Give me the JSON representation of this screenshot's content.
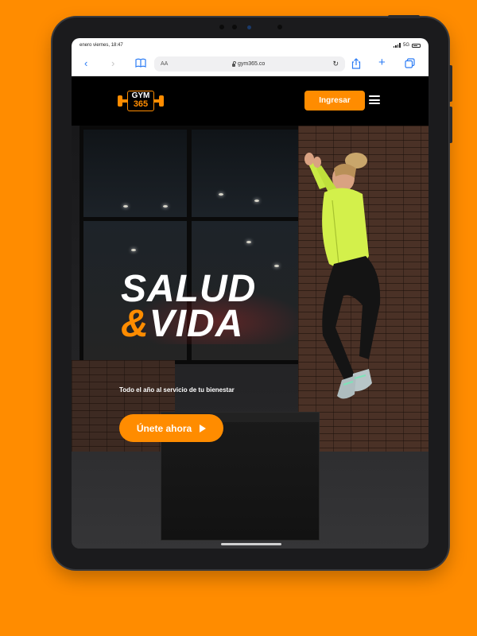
{
  "status_bar": {
    "time": "enero viernes, 18:47",
    "network": "5G"
  },
  "browser": {
    "text_size": "AA",
    "url": "gym365.co"
  },
  "logo": {
    "line1": "GYM",
    "line2": "365"
  },
  "header": {
    "login_label": "Ingresar"
  },
  "hero": {
    "title_line1": "SALUD",
    "title_amp": "&",
    "title_line2": "VIDA",
    "tagline": "Todo el año al servicio de tu bienestar",
    "cta_label": "Únete ahora"
  },
  "colors": {
    "accent": "#FF8C00",
    "browser_blue": "#2A7BF5",
    "header_bg": "#000000"
  }
}
